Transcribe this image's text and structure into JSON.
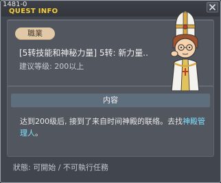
{
  "window": {
    "quest_id": "1481-0",
    "title": "QUEST INFO"
  },
  "quest": {
    "category_badge": "職業",
    "name": "[5转技能和神秘力量] 5转: 新力量..",
    "level_requirement": "建议等级: 200以上"
  },
  "content": {
    "header": "内容",
    "description_lead": "达到200级后, 接到了来自时间神殿的联络。去找",
    "description_npc": "神殿管理人",
    "description_tail": "。"
  },
  "status": {
    "text": "狀態: 可開始 / 不可執行任務"
  },
  "colors": {
    "title": "#f6cf3b",
    "npc_link": "#7ee0ff",
    "badge_bg": "#e1c8a6",
    "header_bg": "#5e6e7d"
  },
  "icons": {
    "close": "close-icon",
    "npc": "npc-portrait"
  }
}
